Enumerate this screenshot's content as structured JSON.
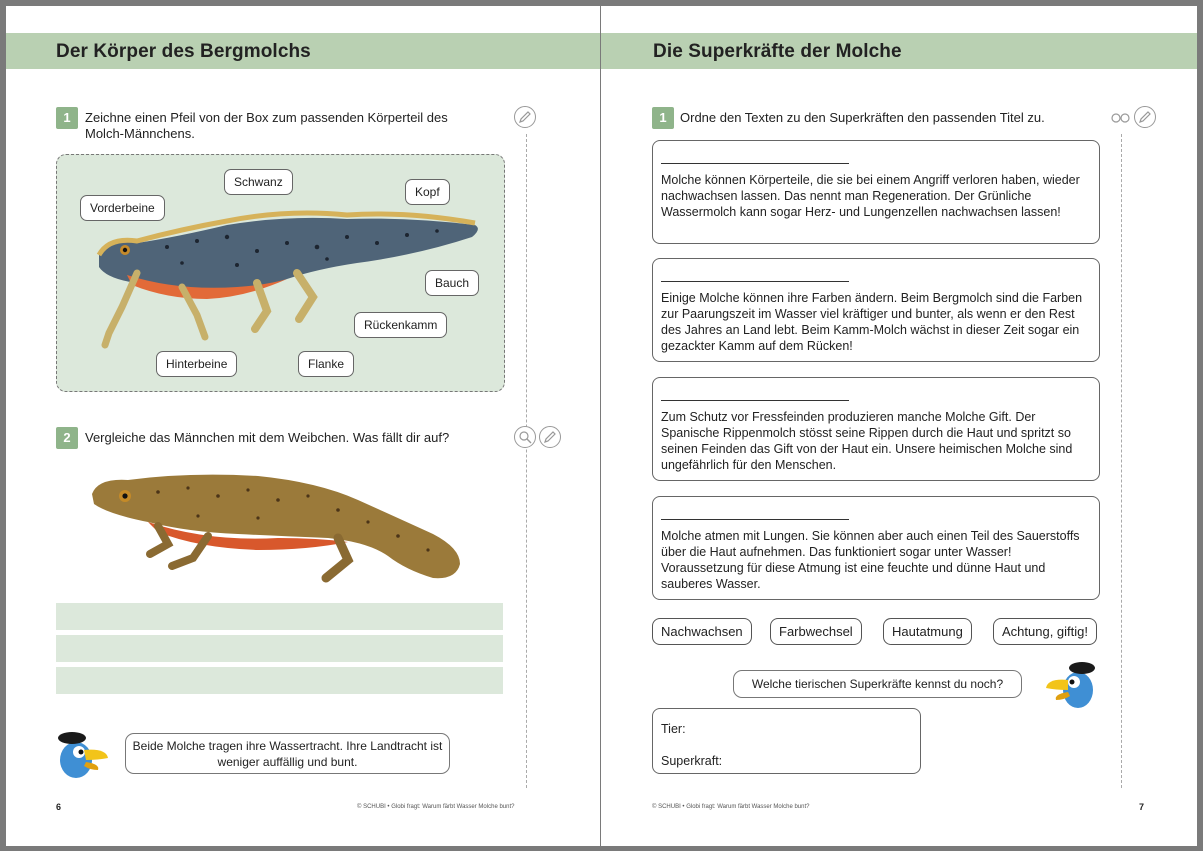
{
  "left": {
    "title": "Der Körper des Bergmolchs",
    "task1": {
      "number": "1",
      "text": "Zeichne einen Pfeil von der Box zum passenden Körperteil des Molch-Männchens."
    },
    "labels": {
      "schwanz": "Schwanz",
      "kopf": "Kopf",
      "vorderbeine": "Vorderbeine",
      "bauch": "Bauch",
      "rueckenkamm": "Rückenkamm",
      "hinterbeine": "Hinterbeine",
      "flanke": "Flanke"
    },
    "task2": {
      "number": "2",
      "text": "Vergleiche das Männchen mit dem Weibchen. Was fällt dir auf?"
    },
    "bubble": "Beide Molche tragen ihre Wassertracht. Ihre Landtracht ist weniger auffällig und bunt.",
    "page_number": "6",
    "footer": "© SCHUBI • Globi fragt: Warum färbt Wasser Molche bunt?"
  },
  "right": {
    "title": "Die Superkräfte der Molche",
    "task1": {
      "number": "1",
      "text": "Ordne den Texten zu den Superkräften den passenden Titel zu."
    },
    "boxes": [
      {
        "text": "Molche können Körperteile, die sie bei einem Angriff verloren haben, wieder nachwachsen lassen. Das nennt man Regeneration. Der Grünliche Wassermolch kann sogar Herz- und Lungenzellen nachwachsen lassen!"
      },
      {
        "text": "Einige Molche können ihre Farben ändern. Beim Bergmolch sind die Farben zur Paarungszeit im Wasser viel kräftiger und bunter, als wenn er den Rest des Jahres an Land lebt. Beim Kamm-Molch wächst in dieser Zeit sogar ein gezackter Kamm auf dem Rücken!"
      },
      {
        "text": "Zum Schutz vor Fressfeinden produzieren manche Molche Gift. Der Spanische Rippenmolch stösst seine Rippen durch die Haut und spritzt so seinen Feinden das Gift von der Haut ein. Unsere heimischen Molche sind ungefährlich für den Menschen."
      },
      {
        "text": "Molche atmen mit Lungen. Sie können aber auch einen Teil des Sauerstoffs über die Haut aufnehmen. Das funktioniert sogar unter Wasser! Voraussetzung für diese Atmung ist eine feuchte und dünne Haut und sauberes Wasser."
      }
    ],
    "options": [
      "Nachwachsen",
      "Farbwechsel",
      "Hautatmung",
      "Achtung, giftig!"
    ],
    "bubble": "Welche tierischen Superkräfte kennst du noch?",
    "answer": {
      "tier": "Tier:",
      "superkraft": "Superkraft:"
    },
    "page_number": "7",
    "footer": "© SCHUBI • Globi fragt: Warum färbt Wasser Molche bunt?"
  },
  "colors": {
    "accent_green": "#b9d0b2",
    "number_green": "#8fb48a",
    "box_green": "#dce8db"
  }
}
